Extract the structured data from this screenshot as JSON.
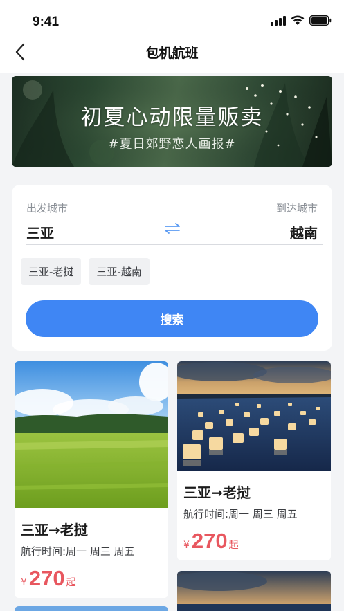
{
  "status_bar": {
    "time": "9:41",
    "icons": [
      "signal-icon",
      "wifi-icon",
      "battery-icon"
    ]
  },
  "nav": {
    "title": "包机航班",
    "back_icon": "chevron-left-icon"
  },
  "banner": {
    "title": "初夏心动限量贩卖",
    "subtitle": "#夏日郊野恋人画报#"
  },
  "search": {
    "from_label": "出发城市",
    "to_label": "到达城市",
    "from_city": "三亚",
    "to_city": "越南",
    "swap_icon": "swap-arrows-icon",
    "history": [
      "三亚-老挝",
      "三亚-越南"
    ],
    "button_label": "搜索"
  },
  "cards": [
    {
      "route": "三亚→老挝",
      "schedule": "航行时间:周一 周三  周五",
      "currency": "¥",
      "price": "270",
      "price_suffix": "起",
      "image": "rice-field-photo"
    },
    {
      "route": "三亚→老挝",
      "schedule": "航行时间:周一 周三  周五",
      "currency": "¥",
      "price": "270",
      "price_suffix": "起",
      "image": "lanterns-on-water-photo"
    }
  ],
  "colors": {
    "accent": "#3f86f4",
    "price": "#e8575f",
    "background": "#f3f4f6"
  }
}
